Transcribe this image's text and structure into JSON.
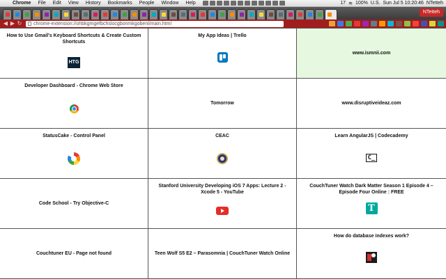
{
  "menubar": {
    "apple": "",
    "menus": [
      "Chrome",
      "File",
      "Edit",
      "View",
      "History",
      "Bookmarks",
      "People",
      "Window",
      "Help"
    ],
    "right": {
      "count": "17",
      "battery": "100%",
      "input": "U.S.",
      "datetime": "Sun Jul 5  10:20:46",
      "user": "NTetteh"
    }
  },
  "tabstrip": {
    "tab_count": 34,
    "user": "NTetteh"
  },
  "toolbar": {
    "back": "◀",
    "forward": "▶",
    "reload": "↻",
    "url": "chrome-extension://ohbkgmgefbchslocgbonmkgobenl/main.html",
    "extension_colors": [
      "#e8a33b",
      "#3b7be8",
      "#4caf50",
      "#e53935",
      "#9c27b0",
      "#607d8b",
      "#ff9800",
      "#00bcd4",
      "#795548",
      "#8bc34a",
      "#f44336",
      "#3f51b5",
      "#cddc39",
      "#009688"
    ]
  },
  "tiles": [
    {
      "title": "How to Use Gmail's Keyboard Shortcuts & Create Custom Shortcuts",
      "icon": "htg-icon",
      "icon_text": "HTG"
    },
    {
      "title": "My App Ideas | Trello",
      "icon": "trello-icon"
    },
    {
      "title": "www.ismnii.com",
      "icon": "",
      "highlighted": true
    },
    {
      "title": "Developer Dashboard - Chrome Web Store",
      "icon": "chrome-icon"
    },
    {
      "title": "Tomorrow",
      "icon": ""
    },
    {
      "title": "www.disruptiveideaz.com",
      "icon": ""
    },
    {
      "title": "StatusCake - Control Panel",
      "icon": "statuscake-icon"
    },
    {
      "title": "CEAC",
      "icon": "state-seal-icon"
    },
    {
      "title": "Learn AngularJS | Codecademy",
      "icon": "codecademy-icon",
      "icon_text": "C_"
    },
    {
      "title": "Code School - Try Objective-C",
      "icon": ""
    },
    {
      "title": "Stanford University Developing iOS 7 Apps: Lecture 2 - Xcode 5 - YouTube",
      "icon": "youtube-icon"
    },
    {
      "title": "CouchTuner Watch Dark Matter Season 1 Episode 4 – Episode Four Online : FREE",
      "icon": "couchtuner-icon",
      "icon_text": "T"
    },
    {
      "title": "Couchtuner EU - Page not found",
      "icon": ""
    },
    {
      "title": "Teen Wolf S5 E2 – Parasomnia | CouchTuner Watch Online",
      "icon": ""
    },
    {
      "title": "How do database indexes work?",
      "icon": "database-indexes-icon"
    }
  ]
}
